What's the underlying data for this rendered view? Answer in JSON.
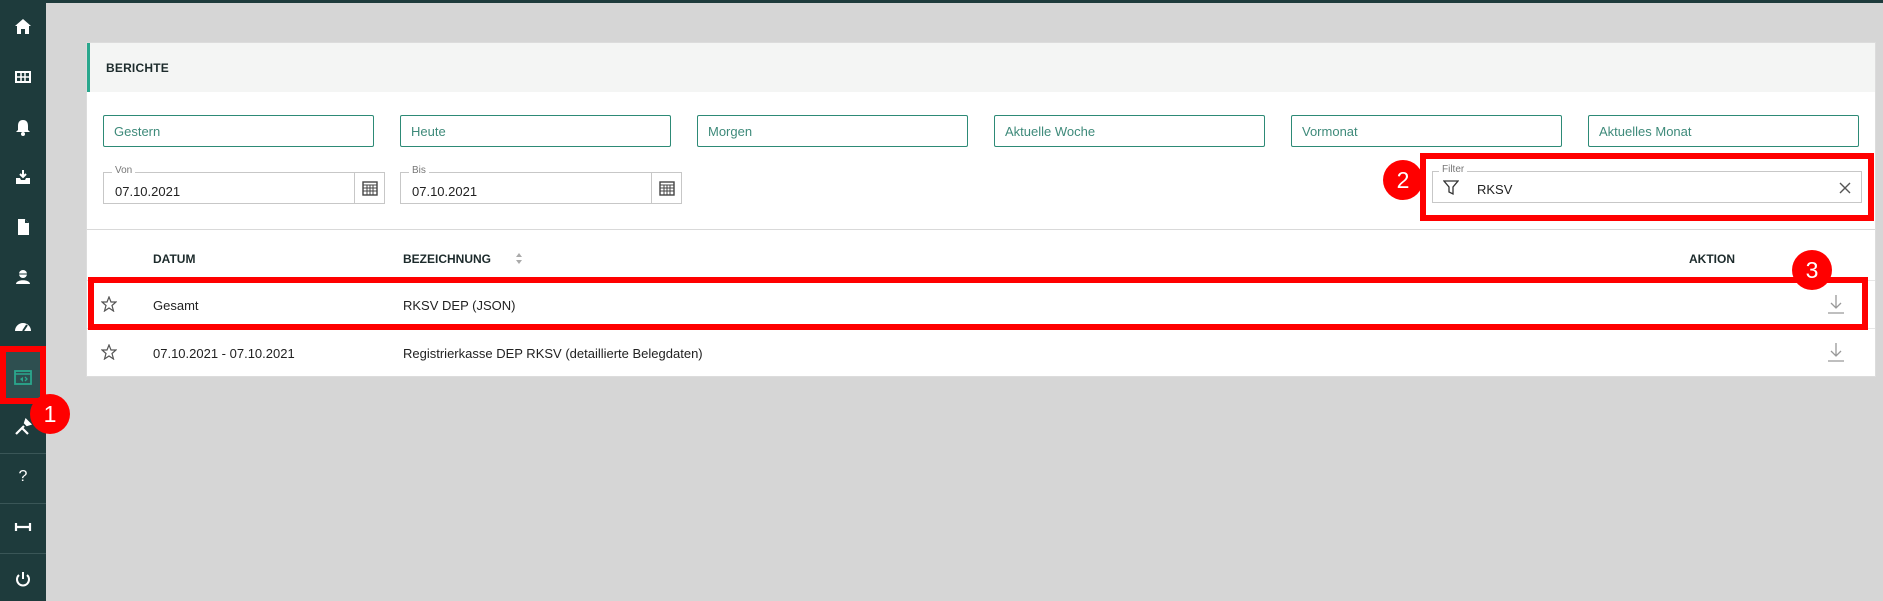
{
  "sidebar": {
    "items": [
      {
        "icon": "home-icon"
      },
      {
        "icon": "grid-icon"
      },
      {
        "icon": "bell-icon"
      },
      {
        "icon": "inbox-icon"
      },
      {
        "icon": "document-icon"
      },
      {
        "icon": "user-icon"
      },
      {
        "icon": "dashboard-icon"
      },
      {
        "icon": "reports-icon"
      },
      {
        "icon": "tools-icon"
      },
      {
        "icon": "help-icon",
        "label": "?"
      },
      {
        "icon": "width-icon"
      },
      {
        "icon": "power-icon"
      }
    ]
  },
  "panel": {
    "title": "BERICHTE"
  },
  "quick_filters": [
    "Gestern",
    "Heute",
    "Morgen",
    "Aktuelle Woche",
    "Vormonat",
    "Aktuelles Monat"
  ],
  "date_from": {
    "label": "Von",
    "value": "07.10.2021"
  },
  "date_to": {
    "label": "Bis",
    "value": "07.10.2021"
  },
  "filter": {
    "label": "Filter",
    "value": "RKSV"
  },
  "table": {
    "headers": {
      "datum": "DATUM",
      "bezeichnung": "BEZEICHNUNG",
      "aktion": "AKTION"
    },
    "rows": [
      {
        "datum": "Gesamt",
        "bezeichnung": "RKSV DEP (JSON)"
      },
      {
        "datum": "07.10.2021 - 07.10.2021",
        "bezeichnung": "Registrierkasse DEP RKSV (detaillierte Belegdaten)"
      }
    ]
  },
  "annotations": {
    "badge1": "1",
    "badge2": "2",
    "badge3": "3"
  },
  "colors": {
    "sidebar": "#1e3b3c",
    "accent": "#2aa78d",
    "highlight": "#ff0000"
  }
}
